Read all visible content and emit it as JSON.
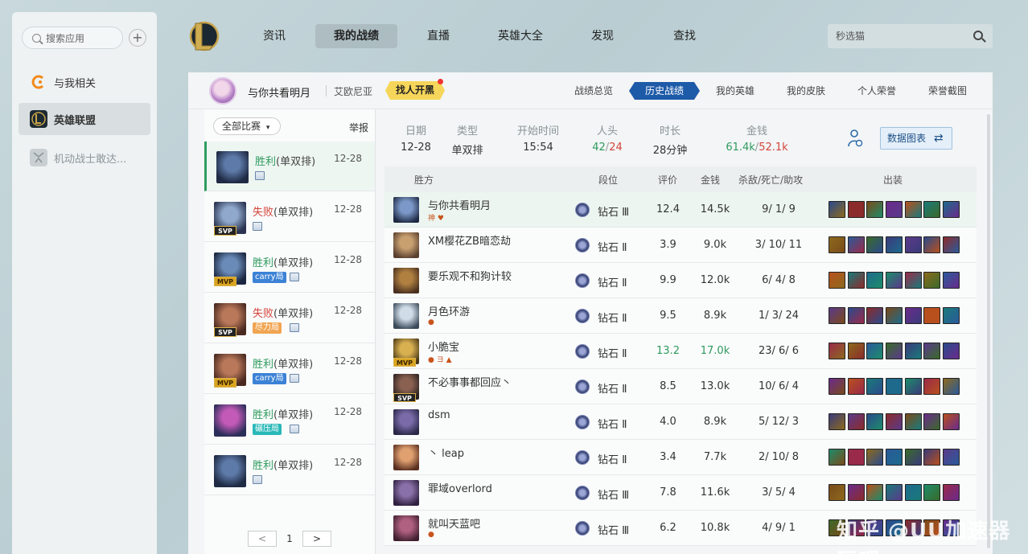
{
  "sidebar": {
    "search_placeholder": "搜索应用",
    "add_label": "+",
    "items": [
      {
        "label": "与我相关",
        "icon": "orange-c-icon"
      },
      {
        "label": "英雄联盟",
        "icon": "lol-logo-icon"
      },
      {
        "label": "机动战士敢达...",
        "icon": "gundam-icon"
      }
    ]
  },
  "nav": {
    "items": [
      "资讯",
      "我的战绩",
      "直播",
      "英雄大全",
      "发现",
      "查找"
    ],
    "active": "我的战绩",
    "search_value": "秒选猫"
  },
  "profile": {
    "name": "与你共看明月",
    "server": "艾欧尼亚",
    "find_button": "找人开黑",
    "tabs": [
      "战绩总览",
      "历史战绩",
      "我的英雄",
      "我的皮肤",
      "个人荣誉",
      "荣誉截图"
    ],
    "active_tab": "历史战绩"
  },
  "game_list": {
    "filter": "全部比赛",
    "report": "举报",
    "queue": "(单双排)",
    "games": [
      {
        "result": "胜利",
        "date": "12-28",
        "tag": "",
        "badge": ""
      },
      {
        "result": "失败",
        "date": "12-28",
        "tag": "",
        "badge": "SVP"
      },
      {
        "result": "胜利",
        "date": "12-28",
        "tag": "carry局",
        "badge": "MVP"
      },
      {
        "result": "失败",
        "date": "12-28",
        "tag": "尽力局",
        "badge": "SVP"
      },
      {
        "result": "胜利",
        "date": "12-28",
        "tag": "carry局",
        "badge": "MVP"
      },
      {
        "result": "胜利",
        "date": "12-28",
        "tag": "碾压局",
        "badge": ""
      },
      {
        "result": "胜利",
        "date": "12-28",
        "tag": "",
        "badge": ""
      }
    ],
    "page": "1",
    "prev": "<",
    "next": ">"
  },
  "summary": {
    "date_label": "日期",
    "date": "12-28",
    "type_label": "类型",
    "type": "单双排",
    "start_label": "开始时间",
    "start": "15:54",
    "kills_label": "人头",
    "kills_a": "42",
    "kills_sep": "/",
    "kills_b": "24",
    "duration_label": "时长",
    "duration": "28分钟",
    "gold_label": "金钱",
    "gold_a": "61.4k",
    "gold_sep": "/",
    "gold_b": "52.1k",
    "chart_button": "数据图表",
    "chart_button_icon": "⇄"
  },
  "table": {
    "headers": {
      "team": "胜方",
      "rank": "段位",
      "score": "评价",
      "gold": "金钱",
      "kda": "杀敌/死亡/助攻",
      "items": "出装"
    },
    "rows": [
      {
        "name": "与你共看明月",
        "badges": "神 ♥",
        "rank": "钻石 Ⅲ",
        "score": "12.4",
        "gold": "14.5k",
        "kda": "9/ 1/ 9",
        "mini": ""
      },
      {
        "name": "XM樱花ZB暗恋劫",
        "badges": "",
        "rank": "钻石 Ⅱ",
        "score": "3.9",
        "gold": "9.0k",
        "kda": "3/ 10/ 11",
        "mini": ""
      },
      {
        "name": "要乐观不和狗计较",
        "badges": "",
        "rank": "钻石 Ⅱ",
        "score": "9.9",
        "gold": "12.0k",
        "kda": "6/ 4/ 8",
        "mini": ""
      },
      {
        "name": "月色环游",
        "badges": "●",
        "rank": "钻石 Ⅱ",
        "score": "9.5",
        "gold": "8.9k",
        "kda": "1/ 3/ 24",
        "mini": ""
      },
      {
        "name": "小脆宝",
        "badges": "● ヨ ▲",
        "rank": "钻石 Ⅱ",
        "score": "13.2",
        "gold": "17.0k",
        "kda": "23/ 6/ 6",
        "mini": "MVP"
      },
      {
        "name": "不必事事都回应丶",
        "badges": "",
        "rank": "钻石 Ⅱ",
        "score": "8.5",
        "gold": "13.0k",
        "kda": "10/ 6/ 4",
        "mini": "SVP"
      },
      {
        "name": "dsm",
        "badges": "",
        "rank": "钻石 Ⅱ",
        "score": "4.0",
        "gold": "8.9k",
        "kda": "5/ 12/ 3",
        "mini": ""
      },
      {
        "name": "丶 leap",
        "badges": "",
        "rank": "钻石 Ⅱ",
        "score": "3.4",
        "gold": "7.7k",
        "kda": "2/ 10/ 8",
        "mini": ""
      },
      {
        "name": "罪域overlord",
        "badges": "",
        "rank": "钻石 Ⅲ",
        "score": "7.8",
        "gold": "11.6k",
        "kda": "3/ 5/ 4",
        "mini": ""
      },
      {
        "name": "就叫天蓝吧",
        "badges": "●",
        "rank": "钻石 Ⅲ",
        "score": "6.2",
        "gold": "10.8k",
        "kda": "4/ 9/ 1",
        "mini": ""
      }
    ]
  },
  "watermark": "知乎 @UU加速器 玩吧",
  "colors": {
    "win": "#2e9b5e",
    "lose": "#d4453b",
    "accent": "#1d5aa8",
    "find_button": "#f6d65a"
  }
}
